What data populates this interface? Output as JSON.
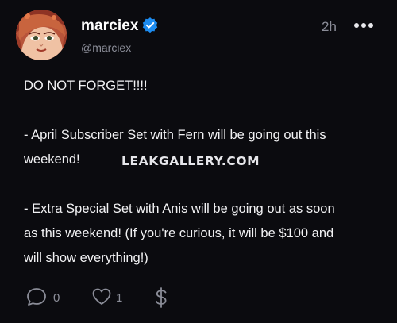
{
  "author": {
    "display_name": "marciex",
    "handle": "@marciex",
    "verified": true,
    "avatar": "avatar-illustration"
  },
  "meta": {
    "timestamp": "2h",
    "more_icon": "more-icon"
  },
  "post": {
    "lines": [
      "DO NOT FORGET!!!!",
      "- April Subscriber Set with Fern will be going out this",
      "weekend!",
      "- Extra Special Set with Anis will be going out as soon",
      "as this weekend! (If you're curious, it will be $100 and",
      "will show everything!)"
    ]
  },
  "watermark": "LEAKGALLERY.COM",
  "actions": {
    "comment_icon": "comment-icon",
    "comment_count": "0",
    "like_icon": "heart-icon",
    "like_count": "1",
    "tip_icon": "dollar-icon"
  },
  "colors": {
    "background": "#0b0b0f",
    "text": "#f2f2f4",
    "muted": "#8b8d98",
    "verified_badge": "#1d8cf0"
  }
}
